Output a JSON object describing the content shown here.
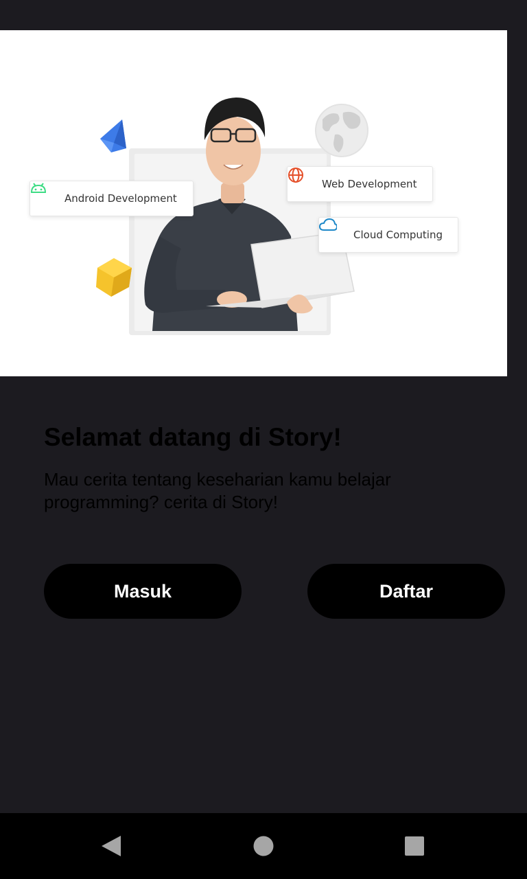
{
  "hero": {
    "chips": {
      "android": {
        "label": "Android Development",
        "icon": "android-icon",
        "color": "#3ddc84"
      },
      "web": {
        "label": "Web Development",
        "icon": "globe-icon",
        "color": "#e5502a"
      },
      "cloud": {
        "label": "Cloud Computing",
        "icon": "cloud-icon",
        "color": "#1e88c8"
      }
    }
  },
  "welcome": {
    "title": "Selamat datang di Story!",
    "subtitle": "Mau cerita tentang keseharian kamu belajar programming? cerita di Story!"
  },
  "actions": {
    "login_label": "Masuk",
    "register_label": "Daftar"
  },
  "navbar": {
    "back": "back-icon",
    "home": "home-icon",
    "recents": "recents-icon"
  },
  "colors": {
    "background": "#1c1b20",
    "button_bg": "#000000",
    "button_text": "#ffffff"
  }
}
